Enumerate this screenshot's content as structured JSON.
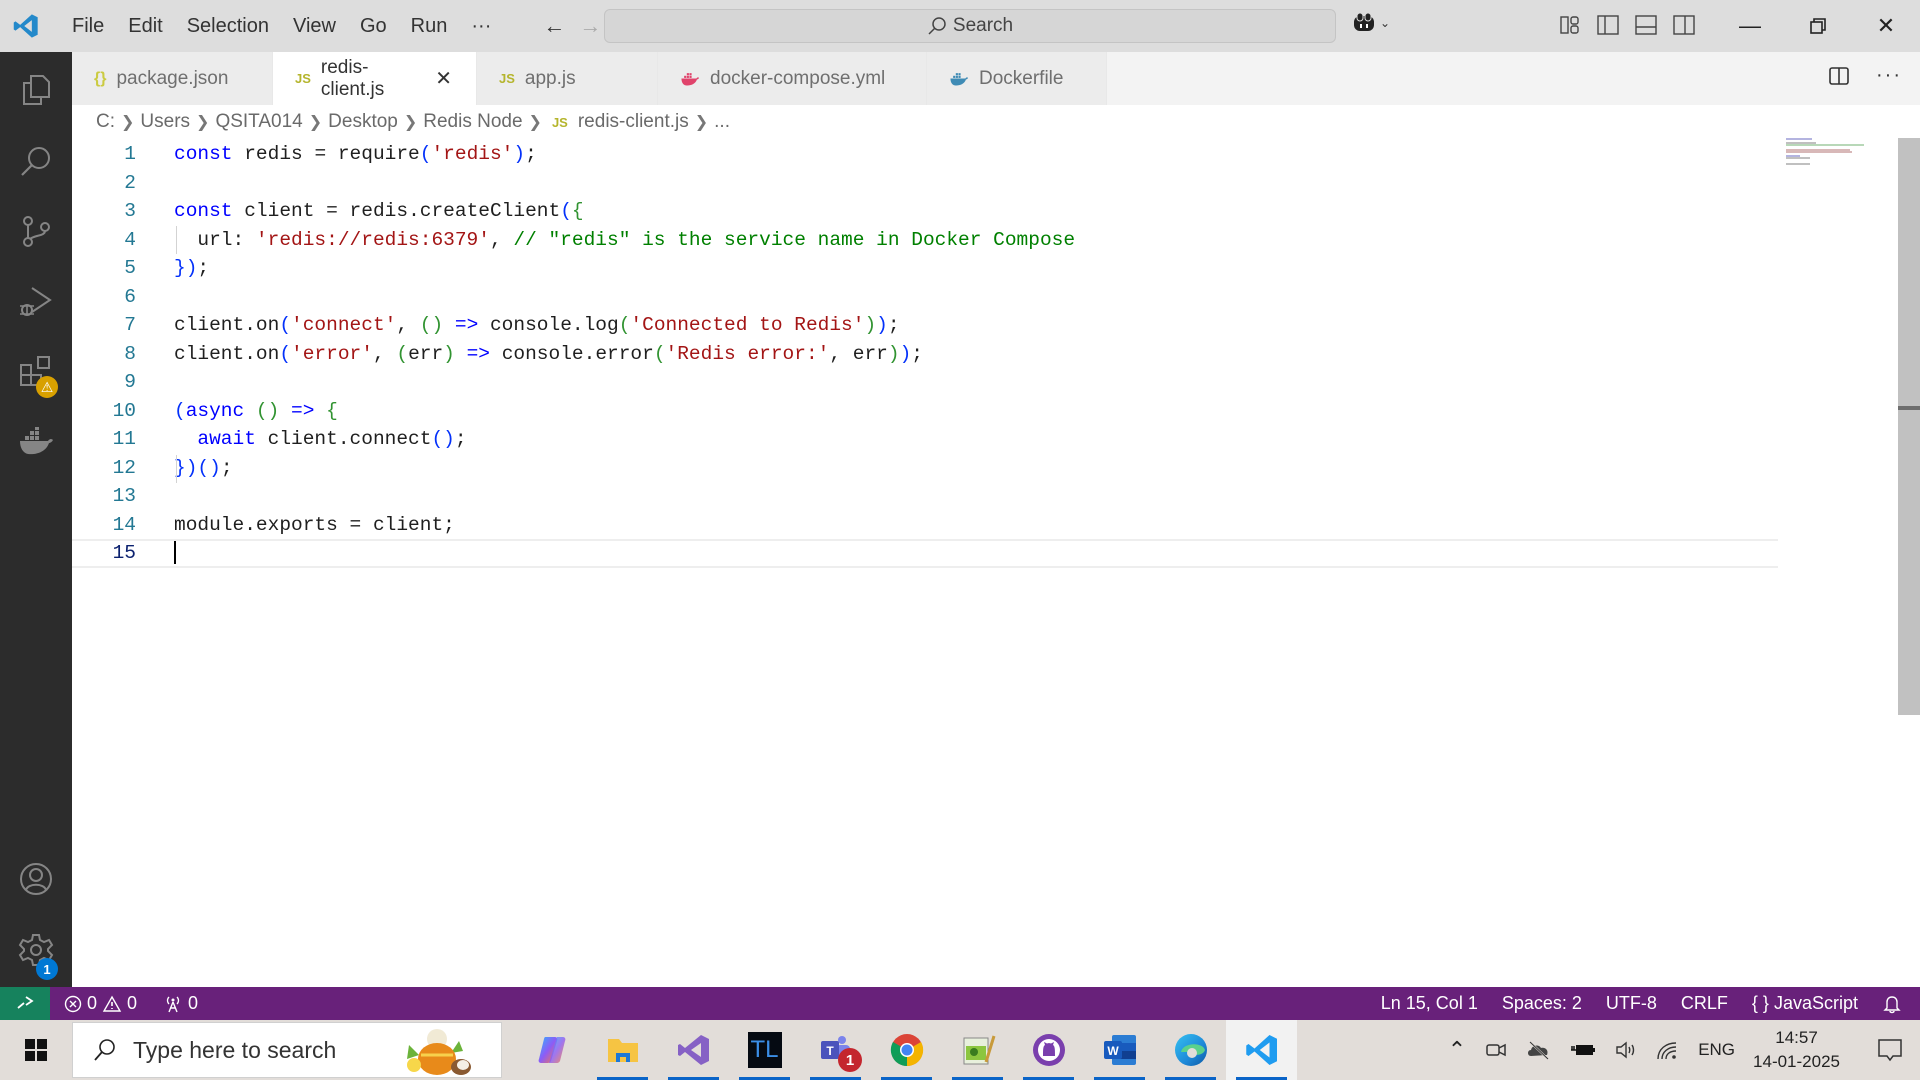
{
  "titlebar": {
    "menu": [
      "File",
      "Edit",
      "Selection",
      "View",
      "Go",
      "Run",
      "···"
    ],
    "search_label": "Search"
  },
  "tabs": [
    {
      "icon": "{}",
      "label": "package.json",
      "icon_color": "#cbcb41",
      "active": false
    },
    {
      "icon": "JS",
      "label": "redis-client.js",
      "icon_color": "#b5b52d",
      "active": true
    },
    {
      "icon": "JS",
      "label": "app.js",
      "icon_color": "#b5b52d",
      "active": false
    },
    {
      "icon": "docker",
      "label": "docker-compose.yml",
      "icon_color": "#e0436b",
      "active": false
    },
    {
      "icon": "docker",
      "label": "Dockerfile",
      "icon_color": "#3f8bb5",
      "active": false
    }
  ],
  "breadcrumb": {
    "parts": [
      "C:",
      "Users",
      "QSITA014",
      "Desktop",
      "Redis Node"
    ],
    "file_icon": "JS",
    "file": "redis-client.js",
    "tail": "..."
  },
  "editor": {
    "line_numbers": [
      "1",
      "2",
      "3",
      "4",
      "5",
      "6",
      "7",
      "8",
      "9",
      "10",
      "11",
      "12",
      "13",
      "14",
      "15"
    ],
    "lines": [
      "const redis = require('redis');",
      "",
      "const client = redis.createClient({",
      "  url: 'redis://redis:6379', // \"redis\" is the service name in Docker Compose",
      "});",
      "",
      "client.on('connect', () => console.log('Connected to Redis'));",
      "client.on('error', (err) => console.error('Redis error:', err));",
      "",
      "(async () => {",
      "  await client.connect();",
      "})();",
      "",
      "module.exports = client;",
      ""
    ],
    "current_line": 15
  },
  "activitybar": {
    "items": [
      "explorer",
      "search",
      "source-control",
      "run-debug",
      "extensions",
      "docker"
    ],
    "extensions_badge": "⚠",
    "settings_badge": "1"
  },
  "statusbar": {
    "errors": "0",
    "warnings": "0",
    "ports": "0",
    "position": "Ln 15, Col 1",
    "spaces": "Spaces: 2",
    "encoding": "UTF-8",
    "eol": "CRLF",
    "language_icon": "{ }",
    "language": "JavaScript"
  },
  "taskbar": {
    "search_placeholder": "Type here to search",
    "apps": [
      "Copilot",
      "File Explorer",
      "Visual Studio",
      "TL",
      "Microsoft Teams",
      "Google Chrome",
      "Notepad++",
      "GitHub Desktop",
      "Microsoft Word",
      "Microsoft Edge",
      "Visual Studio Code"
    ],
    "teams_badge": "1",
    "language": "ENG",
    "time": "14:57",
    "date": "14-01-2025"
  },
  "colors": {
    "statusbar": "#68217a",
    "remote": "#16825d",
    "activitybar": "#2c2c2c",
    "line_number": "#237893"
  }
}
